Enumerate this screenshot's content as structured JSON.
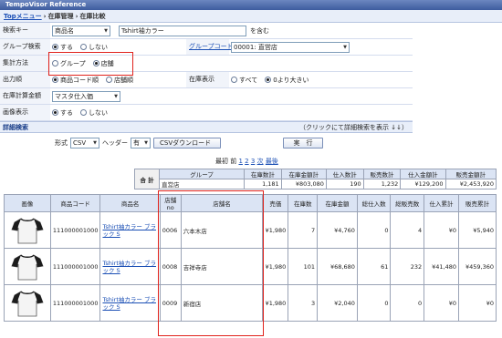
{
  "app_title": "TempoVisor Reference",
  "breadcrumb": {
    "home": "Topメニュー",
    "section": "在庫管理",
    "page": "在庫比較"
  },
  "form": {
    "search_key": {
      "label": "検索キー",
      "field": "商品名",
      "value": "Tshirt袖カラー",
      "suffix": "を含む"
    },
    "group_search": {
      "label": "グループ検索",
      "yes": "する",
      "no": "しない"
    },
    "group_code": {
      "label": "グループコード",
      "value": "00001: 直営店"
    },
    "aggregate": {
      "label": "集計方法",
      "group": "グループ",
      "store": "店舗"
    },
    "order": {
      "label": "出力順",
      "opt1": "商品コード順",
      "opt2": "店舗順"
    },
    "stock_display": {
      "label": "在庫表示",
      "opt1": "すべて",
      "opt2": "0より大きい"
    },
    "stock_amount": {
      "label": "在庫計算金額",
      "value": "マスタ仕入価"
    },
    "image_display": {
      "label": "画像表示",
      "yes": "する",
      "no": "しない"
    }
  },
  "detail": {
    "label": "詳細検索",
    "hint": "（クリックにて詳細検索を表示 ↓↓）"
  },
  "export": {
    "format_label": "形式",
    "format": "CSV",
    "header_label": "ヘッダー",
    "header": "有",
    "download": "CSVダウンロード",
    "run": "実　行"
  },
  "pager": {
    "first": "最初",
    "prev": "前",
    "pages": [
      "1",
      "2",
      "3"
    ],
    "next": "次",
    "last": "最後"
  },
  "summary": {
    "total_label": "合 計",
    "headers": [
      "グループ",
      "在庫数計",
      "在庫金額計",
      "仕入数計",
      "販売数計",
      "仕入金額計",
      "販売金額計"
    ],
    "row": [
      "直営店",
      "1,181",
      "¥803,080",
      "190",
      "1,232",
      "¥129,200",
      "¥2,453,920"
    ]
  },
  "table": {
    "headers": [
      "画像",
      "商品コード",
      "商品名",
      "店舗no",
      "店舗名",
      "売価",
      "在庫数",
      "在庫金額",
      "総仕入数",
      "総販売数",
      "仕入累計",
      "販売累計"
    ],
    "rows": [
      [
        "111000001000",
        "Tshirt袖カラー ブラック S",
        "0006",
        "六本木店",
        "¥1,980",
        "7",
        "¥4,760",
        "0",
        "4",
        "¥0",
        "¥5,940"
      ],
      [
        "111000001000",
        "Tshirt袖カラー ブラック S",
        "0008",
        "吉祥寺店",
        "¥1,980",
        "101",
        "¥68,680",
        "61",
        "232",
        "¥41,480",
        "¥459,360"
      ],
      [
        "111000001000",
        "Tshirt袖カラー ブラック S",
        "0009",
        "新宿店",
        "¥1,980",
        "3",
        "¥2,040",
        "0",
        "0",
        "¥0",
        "¥0"
      ]
    ]
  }
}
